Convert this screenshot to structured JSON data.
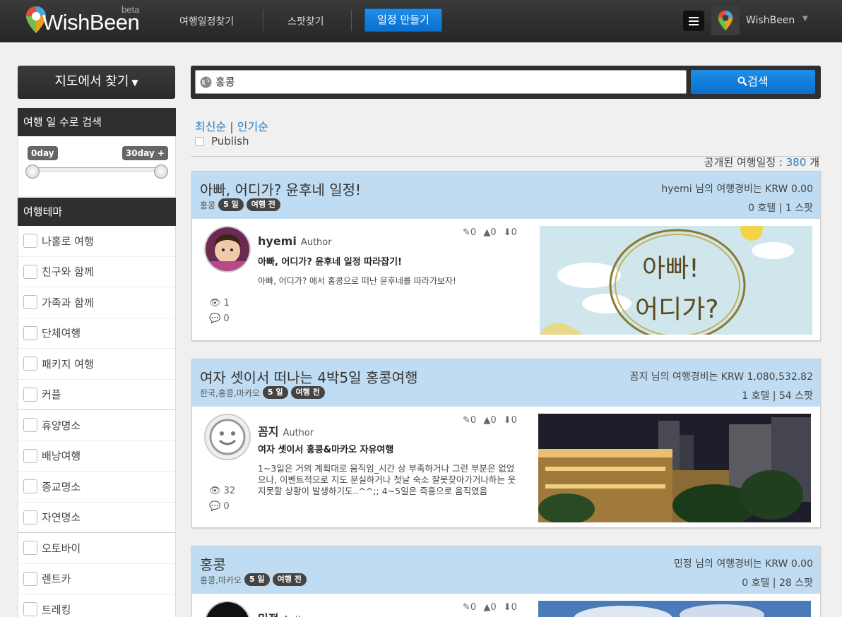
{
  "header": {
    "logo_text": "WishBeen",
    "logo_beta": "beta",
    "nav": [
      "여행일정찾기",
      "스팟찾기"
    ],
    "create_label": "일정 만들기",
    "user_name": "WishBeen"
  },
  "sidebar": {
    "map_button": "지도에서 찾기",
    "days_title": "여행 일 수로 검색",
    "day_min": "0day",
    "day_max": "30day +",
    "theme_title": "여행테마",
    "themes": [
      "나홀로 여행",
      "친구와 함께",
      "가족과 함께",
      "단체여행",
      "패키지 여행",
      "커플",
      "휴양명소",
      "배낭여행",
      "종교명소",
      "자연명소",
      "오토바이",
      "렌트카",
      "트레킹"
    ]
  },
  "search": {
    "value": "홍콩",
    "button": "검색"
  },
  "sort": {
    "latest": "최신순",
    "sep": "|",
    "popular": "인기순"
  },
  "publish_label": "Publish",
  "count": {
    "label": "공개된 여행일정 :",
    "value": "380",
    "unit": "개"
  },
  "cards": [
    {
      "title": "아빠, 어디가? 윤후네 일정!",
      "location": "홍콩",
      "days": "5 일",
      "status": "여행 전",
      "cost": "hyemi 님의 여행경비는 KRW 0.00",
      "counts": "0 호텔 | 1 스팟",
      "author": "hyemi",
      "role": "Author",
      "stats": "0  0  0",
      "plan_title": "아빠, 어디가? 윤후네 일정 따라잡기!",
      "plan_desc": "아빠, 어디가? 에서 홍콩으로 떠난 윤후네를 따라가보자!",
      "views": "1",
      "comments": "0",
      "thumb_text_1": "아빠!",
      "thumb_text_2": "어디가?"
    },
    {
      "title": "여자 셋이서 떠나는 4박5일 홍콩여행",
      "location": "한국,홍콩,마카오",
      "days": "5 일",
      "status": "여행 전",
      "cost": "꼼지 님의 여행경비는 KRW 1,080,532.82",
      "counts": "1 호텔 | 54 스팟",
      "author": "꼼지",
      "role": "Author",
      "stats": "0  0  0",
      "plan_title": "여자 셋이서 홍콩&마카오 자유여행",
      "plan_desc": "1~3일은 거의 계획대로 움직임_시간 상 부족하거나 그런 부분은 없었으나, 이벤트적으로 지도 분실하거나 첫날 숙소 잘못찾아가거나하는 웃지못할 상황이 발생하기도..^^;; 4~5일은 즉흥으로 움직였음",
      "views": "32",
      "comments": "0"
    },
    {
      "title": "홍콩",
      "location": "홍콩,마카오",
      "days": "5 일",
      "status": "여행 전",
      "cost": "민정 님의 여행경비는 KRW 0.00",
      "counts": "0 호텔 | 28 스팟",
      "author": "민정",
      "role": "Author",
      "stats": "0  0  0"
    }
  ]
}
